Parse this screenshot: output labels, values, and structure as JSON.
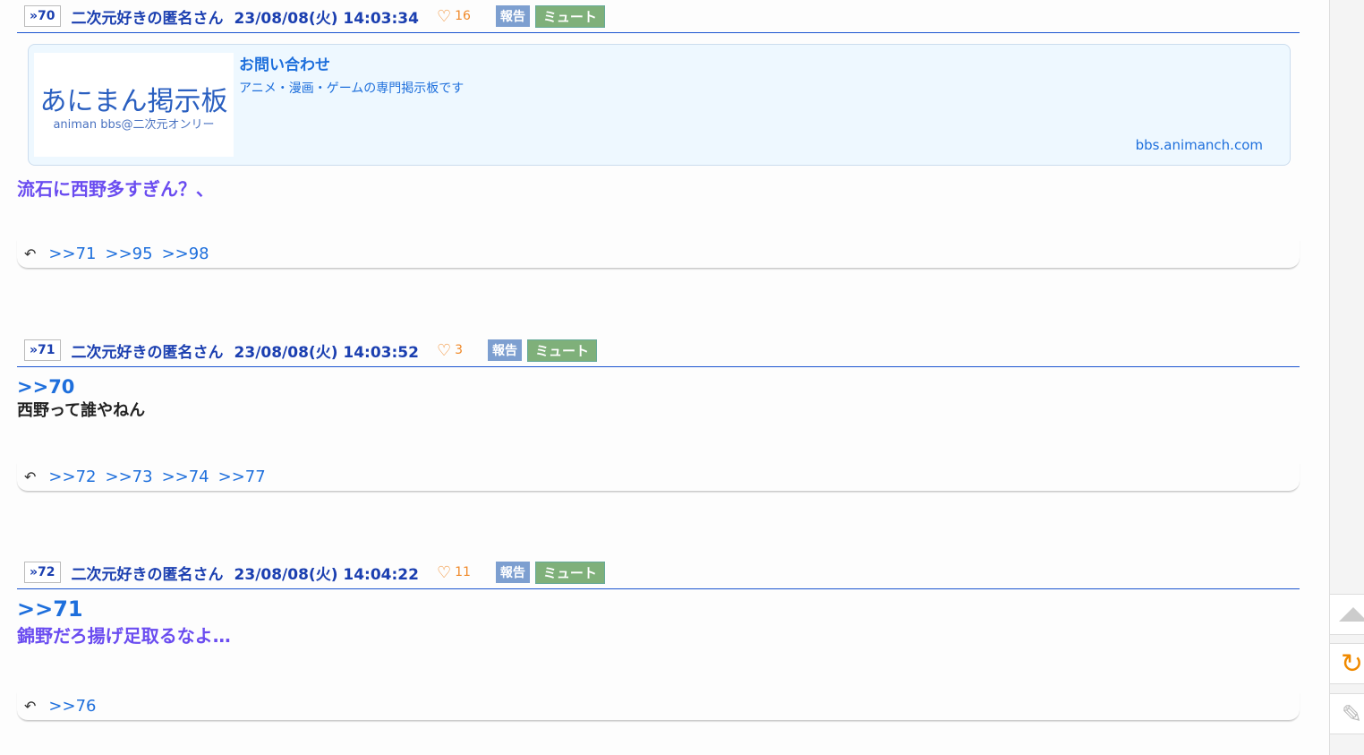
{
  "posts": [
    {
      "num": "»70",
      "name": "二次元好きの匿名さん",
      "date": "23/08/08(火) 14:03:34",
      "likes": "16",
      "report": "報告",
      "mute": "ミュート",
      "card": {
        "logo_main": "あにまん掲示板",
        "logo_sub": "animan bbs@二次元オンリー",
        "title": "お問い合わせ",
        "desc": "アニメ・漫画・ゲームの専門掲示板です",
        "url": "bbs.animanch.com"
      },
      "body": "流石に西野多すぎん？、",
      "replies": [
        ">>71",
        ">>95",
        ">>98"
      ]
    },
    {
      "num": "»71",
      "name": "二次元好きの匿名さん",
      "date": "23/08/08(火) 14:03:52",
      "likes": "3",
      "report": "報告",
      "mute": "ミュート",
      "anchor": ">>70",
      "body": "西野って誰やねん",
      "replies": [
        ">>72",
        ">>73",
        ">>74",
        ">>77"
      ]
    },
    {
      "num": "»72",
      "name": "二次元好きの匿名さん",
      "date": "23/08/08(火) 14:04:22",
      "likes": "11",
      "report": "報告",
      "mute": "ミュート",
      "anchor": ">>71",
      "body": "錦野だろ揚げ足取るなよ…",
      "replies": [
        ">>76"
      ]
    }
  ]
}
